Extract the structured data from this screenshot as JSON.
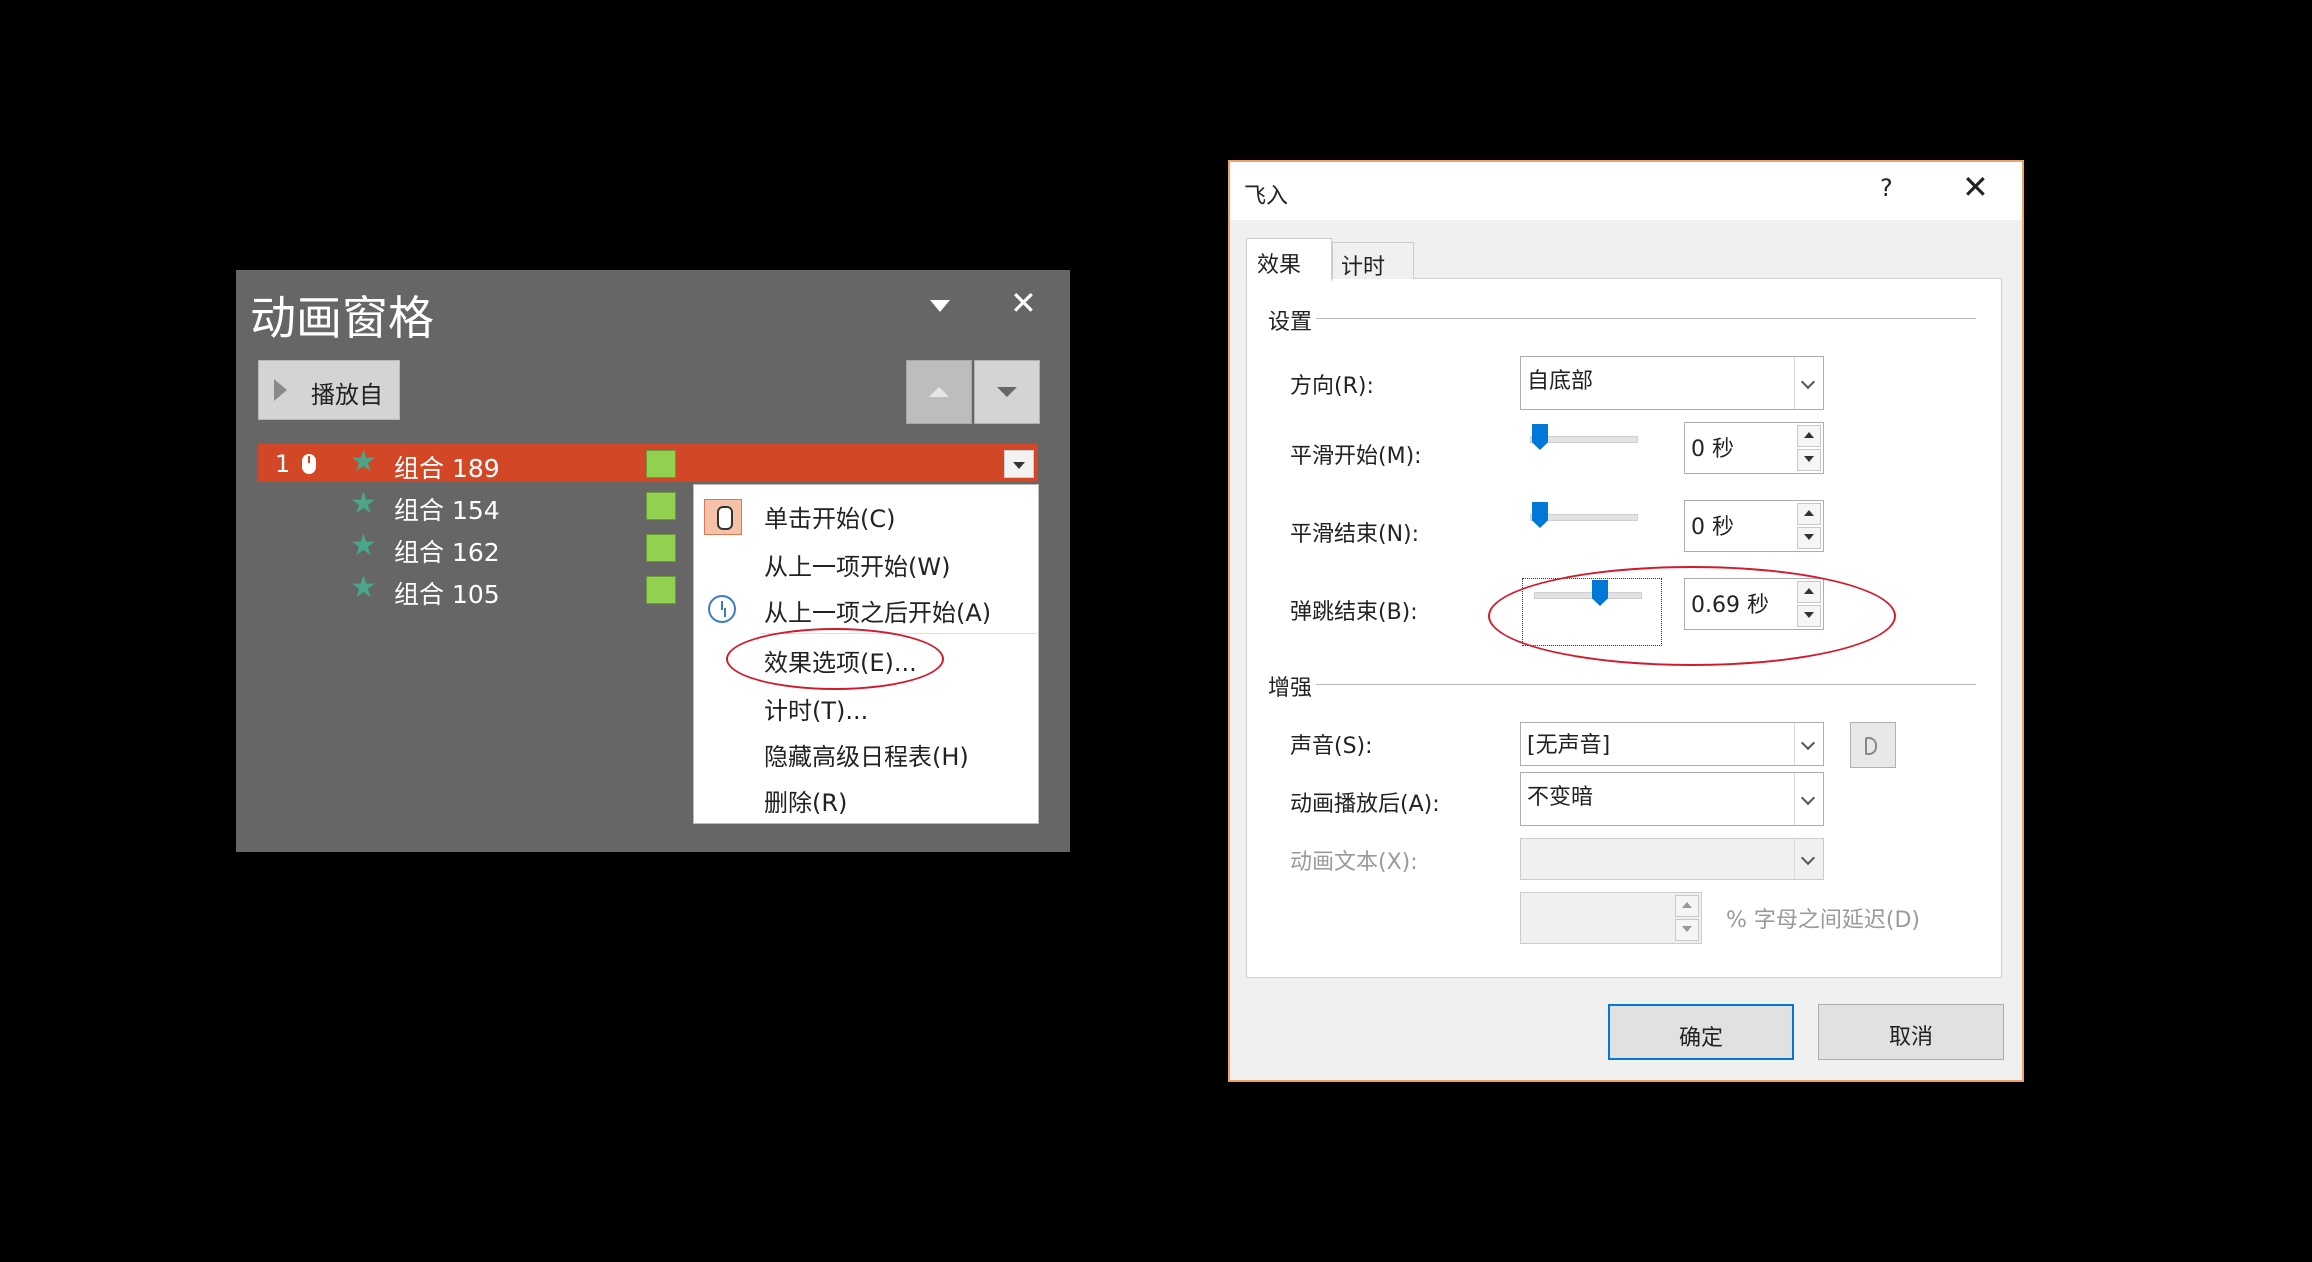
{
  "animation_pane": {
    "title": "动画窗格",
    "play_button_label": "播放自",
    "rows": [
      {
        "num": "1",
        "label": "组合 189",
        "selected": true
      },
      {
        "num": "",
        "label": "组合 154",
        "selected": false
      },
      {
        "num": "",
        "label": "组合 162",
        "selected": false
      },
      {
        "num": "",
        "label": "组合 105",
        "selected": false
      }
    ],
    "context_menu": {
      "items": [
        {
          "text": "单击开始(C)"
        },
        {
          "text": "从上一项开始(W)"
        },
        {
          "text": "从上一项之后开始(A)"
        },
        {
          "text": "效果选项(E)..."
        },
        {
          "text": "计时(T)..."
        },
        {
          "text": "隐藏高级日程表(H)"
        },
        {
          "text": "删除(R)"
        }
      ]
    }
  },
  "dialog": {
    "title": "飞入",
    "help": "?",
    "close": "✕",
    "tabs": {
      "effect": "效果",
      "timing": "计时"
    },
    "settings_section": "设置",
    "enhance_section": "增强",
    "fields": {
      "direction": {
        "label": "方向(R):",
        "value": "自底部"
      },
      "smooth_start": {
        "label": "平滑开始(M):",
        "value": "0 秒",
        "level": 0
      },
      "smooth_end": {
        "label": "平滑结束(N):",
        "value": "0 秒",
        "level": 0
      },
      "bounce_end": {
        "label": "弹跳结束(B):",
        "value": "0.69 秒",
        "level": 0.69
      },
      "sound": {
        "label": "声音(S):",
        "value": "[无声音]"
      },
      "after_animation": {
        "label": "动画播放后(A):",
        "value": "不变暗"
      },
      "animate_text": {
        "label": "动画文本(X):",
        "value": ""
      },
      "letter_delay": {
        "label": "% 字母之间延迟(D)",
        "value": ""
      }
    },
    "ok_label": "确定",
    "cancel_label": "取消"
  },
  "colors": {
    "pane_bg": "#666666",
    "selected_row": "#d24726",
    "annotation_red": "#d21a2a",
    "slider_blue": "#0078d7",
    "dialog_border": "#f0a06a"
  }
}
